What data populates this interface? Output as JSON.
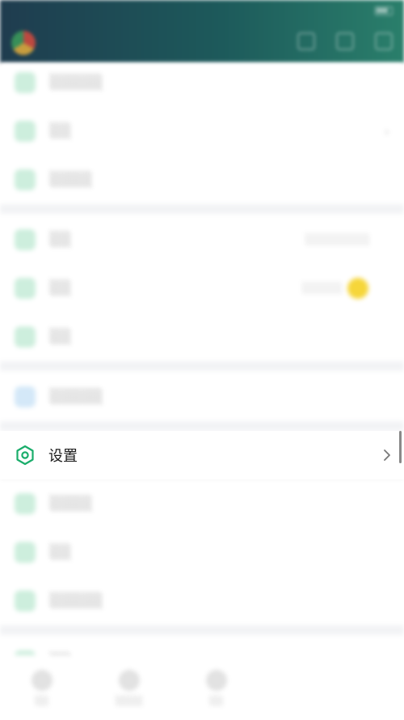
{
  "focused_item": {
    "label": "设置",
    "icon": "settings-hexagon-icon",
    "accent_color": "#1aad6b"
  },
  "colors": {
    "header_start": "#1f3c4f",
    "header_end": "#2a7f6b",
    "icon_green": "#1aad6b"
  },
  "blurred_menu": {
    "rows_before_focus": 7,
    "rows_after_focus": 4,
    "coin_badge": "yellow-coin-icon"
  }
}
